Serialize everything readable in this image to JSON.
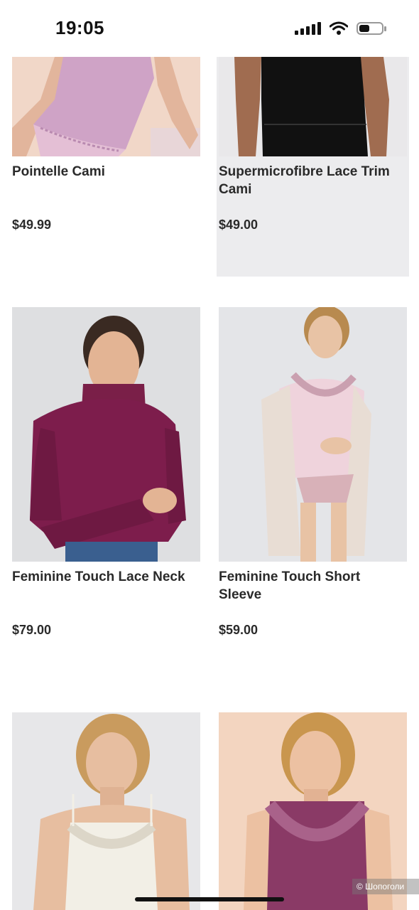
{
  "status_bar": {
    "time": "19:05"
  },
  "products": [
    {
      "name": "Pointelle Cami",
      "price": "$49.99"
    },
    {
      "name": "Supermicrofibre Lace Trim Cami",
      "price": "$49.00"
    },
    {
      "name": "Feminine Touch Lace Neck",
      "price": "$79.00"
    },
    {
      "name": "Feminine Touch Short Sleeve",
      "price": "$59.00"
    },
    {
      "name": "",
      "price": ""
    },
    {
      "name": "",
      "price": ""
    }
  ],
  "watermark": "© Шопоголи",
  "icons": [
    "signal-icon",
    "wifi-icon",
    "battery-icon"
  ]
}
